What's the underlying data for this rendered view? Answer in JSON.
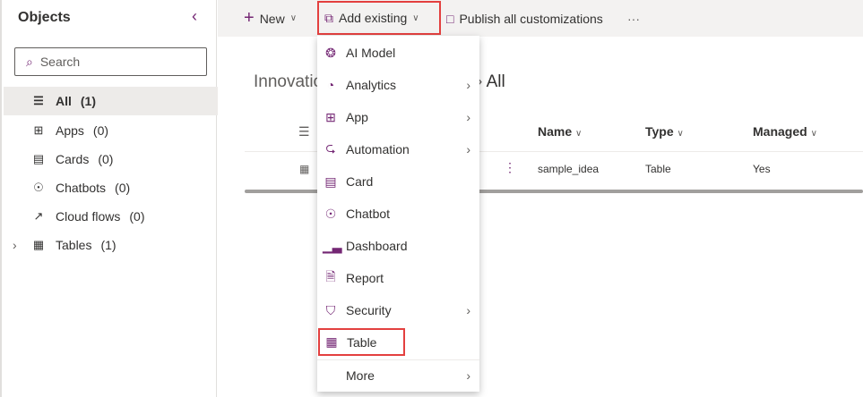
{
  "sidebar": {
    "title": "Objects",
    "search_placeholder": "Search",
    "items": [
      {
        "label": "All",
        "count": "(1)",
        "icon": "list-icon"
      },
      {
        "label": "Apps",
        "count": "(0)",
        "icon": "apps-icon"
      },
      {
        "label": "Cards",
        "count": "(0)",
        "icon": "card-icon"
      },
      {
        "label": "Chatbots",
        "count": "(0)",
        "icon": "chatbot-icon"
      },
      {
        "label": "Cloud flows",
        "count": "(0)",
        "icon": "flow-icon"
      },
      {
        "label": "Tables",
        "count": "(1)",
        "icon": "table-icon"
      }
    ]
  },
  "toolbar": {
    "new": "New",
    "add_existing": "Add existing",
    "publish": "Publish all customizations",
    "more": "···"
  },
  "breadcrumb": {
    "solution": "Innovatio",
    "current": "All"
  },
  "table": {
    "headers": [
      "Name",
      "Type",
      "Managed"
    ],
    "rows": [
      {
        "name": "sample_idea",
        "type": "Table",
        "managed": "Yes"
      }
    ]
  },
  "menu": {
    "items": [
      {
        "label": "AI Model",
        "sub": false
      },
      {
        "label": "Analytics",
        "sub": true
      },
      {
        "label": "App",
        "sub": true
      },
      {
        "label": "Automation",
        "sub": true
      },
      {
        "label": "Card",
        "sub": false
      },
      {
        "label": "Chatbot",
        "sub": false
      },
      {
        "label": "Dashboard",
        "sub": false
      },
      {
        "label": "Report",
        "sub": false
      },
      {
        "label": "Security",
        "sub": true
      },
      {
        "label": "Table",
        "sub": false
      },
      {
        "label": "More",
        "sub": true
      }
    ]
  }
}
